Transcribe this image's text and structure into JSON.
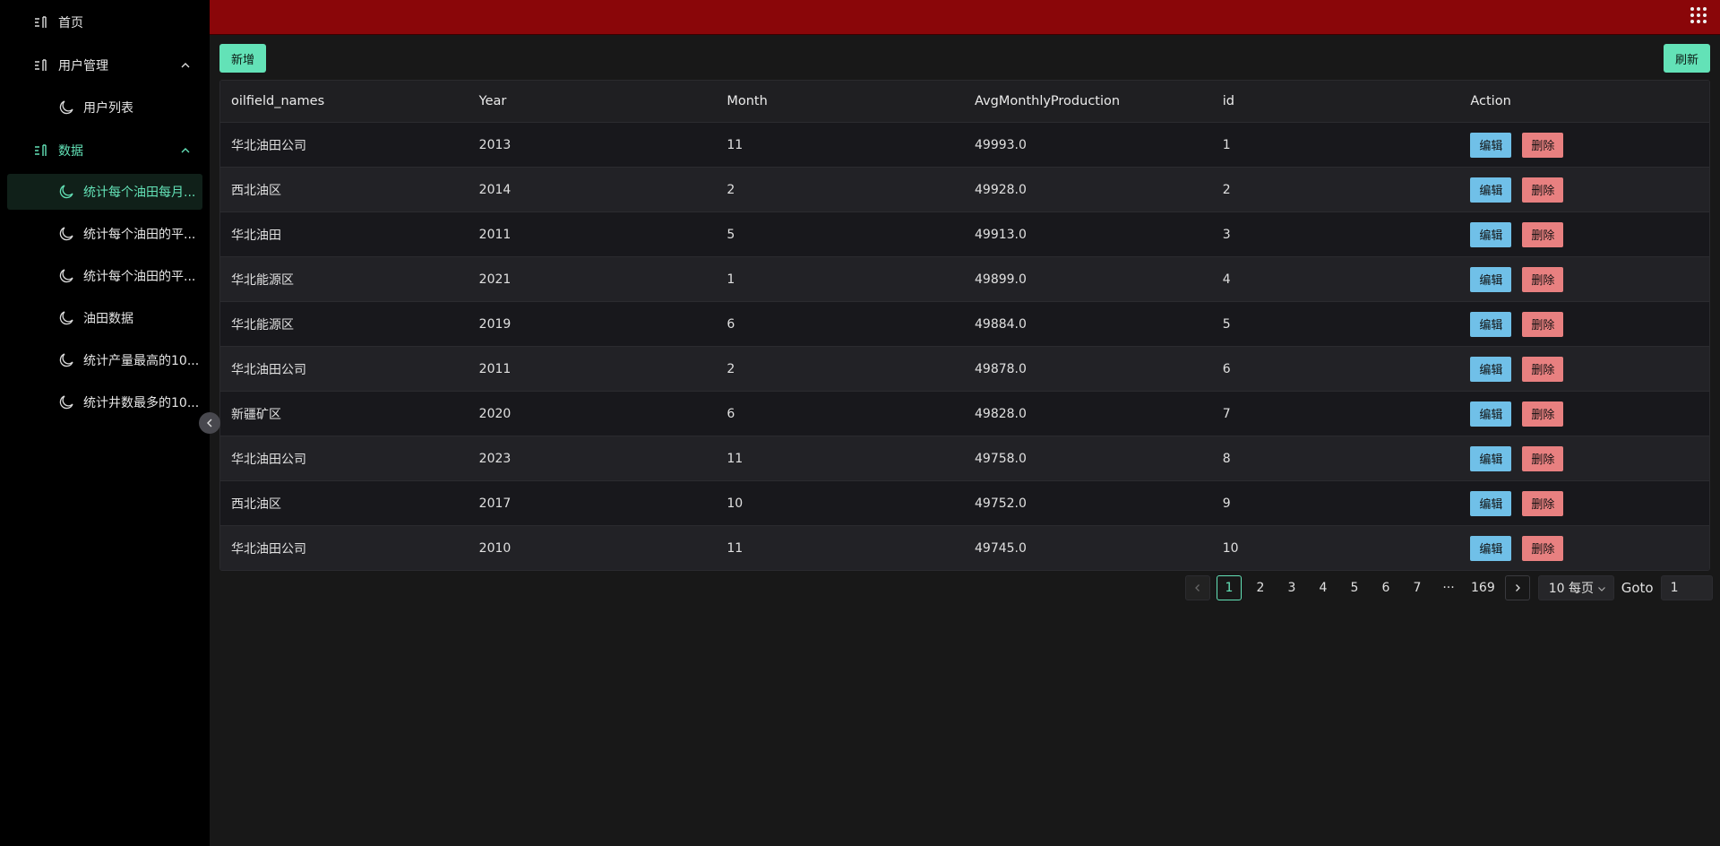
{
  "colors": {
    "accent": "#63e2b7",
    "header": "#8a0609",
    "edit": "#70c0e8",
    "delete": "#e88080"
  },
  "sidebar": {
    "home": "首页",
    "user_mgmt": "用户管理",
    "user_list": "用户列表",
    "data": "数据",
    "data_items": [
      "统计每个油田每月...",
      "统计每个油田的平...",
      "统计每个油田的平...",
      "油田数据",
      "统计产量最高的10...",
      "统计井数最多的10..."
    ]
  },
  "toolbar": {
    "add_label": "新增",
    "refresh_label": "刷新"
  },
  "table": {
    "headers": [
      "oilfield_names",
      "Year",
      "Month",
      "AvgMonthlyProduction",
      "id",
      "Action"
    ],
    "edit_label": "编辑",
    "delete_label": "删除",
    "rows": [
      [
        "华北油田公司",
        "2013",
        "11",
        "49993.0",
        "1"
      ],
      [
        "西北油区",
        "2014",
        "2",
        "49928.0",
        "2"
      ],
      [
        "华北油田",
        "2011",
        "5",
        "49913.0",
        "3"
      ],
      [
        "华北能源区",
        "2021",
        "1",
        "49899.0",
        "4"
      ],
      [
        "华北能源区",
        "2019",
        "6",
        "49884.0",
        "5"
      ],
      [
        "华北油田公司",
        "2011",
        "2",
        "49878.0",
        "6"
      ],
      [
        "新疆矿区",
        "2020",
        "6",
        "49828.0",
        "7"
      ],
      [
        "华北油田公司",
        "2023",
        "11",
        "49758.0",
        "8"
      ],
      [
        "西北油区",
        "2017",
        "10",
        "49752.0",
        "9"
      ],
      [
        "华北油田公司",
        "2010",
        "11",
        "49745.0",
        "10"
      ]
    ]
  },
  "pagination": {
    "pages": [
      "1",
      "2",
      "3",
      "4",
      "5",
      "6",
      "7",
      "···",
      "169"
    ],
    "current": "1",
    "page_size": "10 每页",
    "goto_label": "Goto",
    "goto_value": "1"
  }
}
